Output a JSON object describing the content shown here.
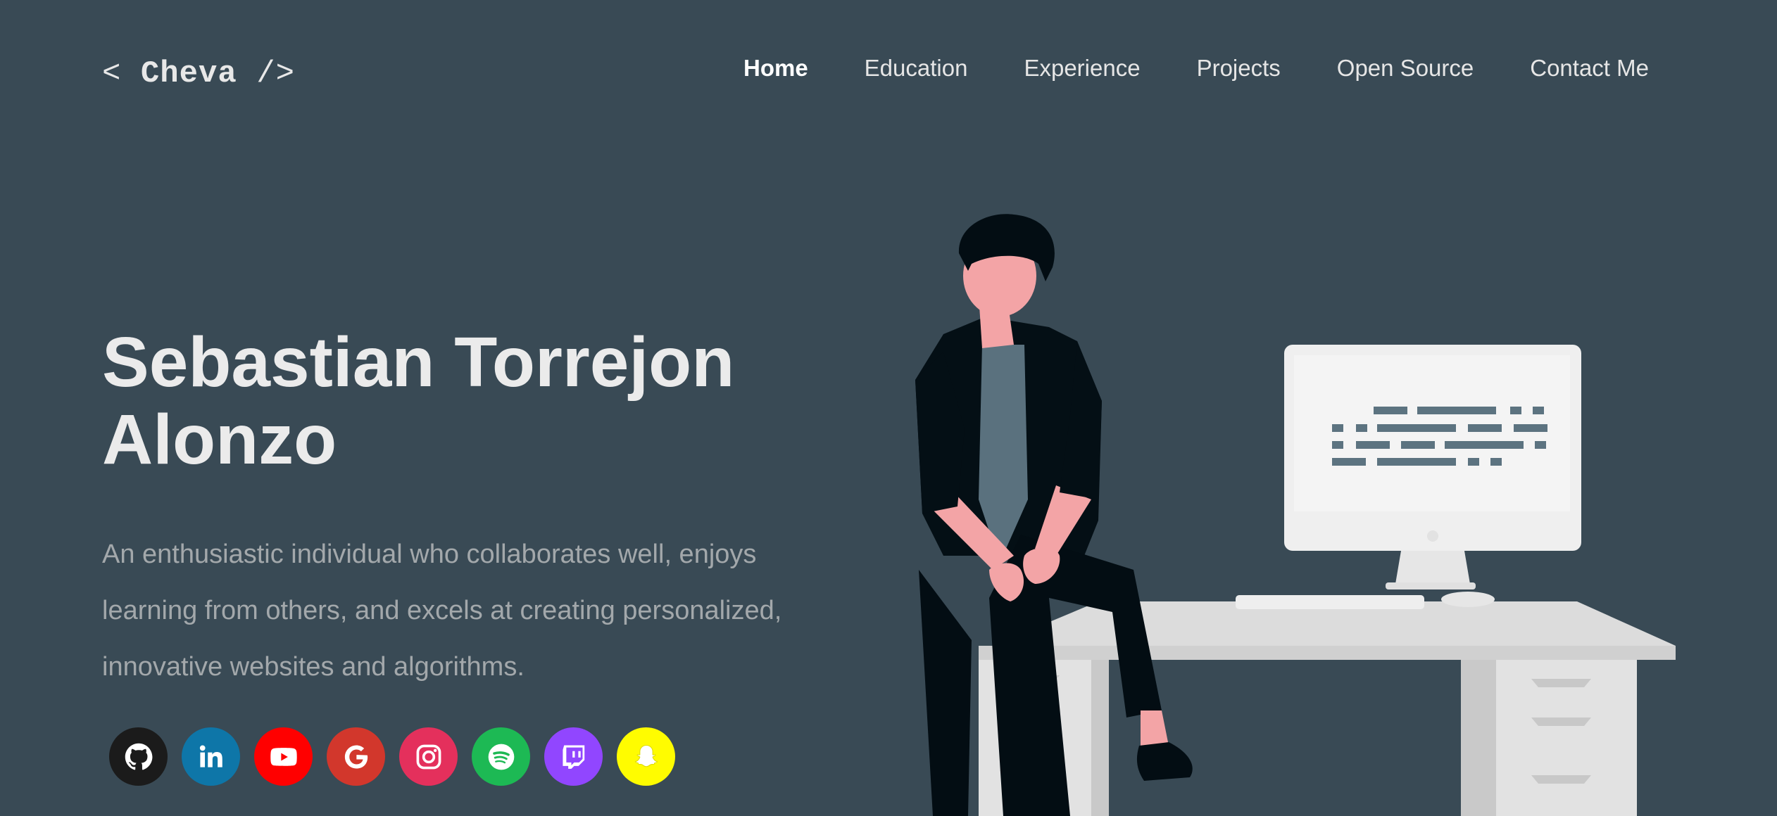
{
  "logo": {
    "open": "< ",
    "name": "Cheva",
    "close": " />"
  },
  "nav": {
    "items": [
      {
        "label": "Home",
        "active": true
      },
      {
        "label": "Education",
        "active": false
      },
      {
        "label": "Experience",
        "active": false
      },
      {
        "label": "Projects",
        "active": false
      },
      {
        "label": "Open Source",
        "active": false
      },
      {
        "label": "Contact Me",
        "active": false
      }
    ]
  },
  "hero": {
    "title": "Sebastian Torrejon Alonzo",
    "description": "An enthusiastic individual who collaborates well, enjoys learning from others, and excels at creating personalized, innovative websites and algorithms."
  },
  "socials": [
    {
      "icon": "github-icon",
      "color": "#1b1b1b"
    },
    {
      "icon": "linkedin-icon",
      "color": "#0e76a8"
    },
    {
      "icon": "youtube-icon",
      "color": "#ff0000"
    },
    {
      "icon": "google-icon",
      "color": "#d2372c"
    },
    {
      "icon": "instagram-icon",
      "color": "#e4305c"
    },
    {
      "icon": "spotify-icon",
      "color": "#1db954"
    },
    {
      "icon": "twitch-icon",
      "color": "#9146ff"
    },
    {
      "icon": "snapchat-icon",
      "color": "#fffc00"
    }
  ],
  "colors": {
    "background": "#394a55",
    "title": "#ebebeb",
    "description": "#a3a8ab",
    "nav_text": "#e6e6e6"
  }
}
